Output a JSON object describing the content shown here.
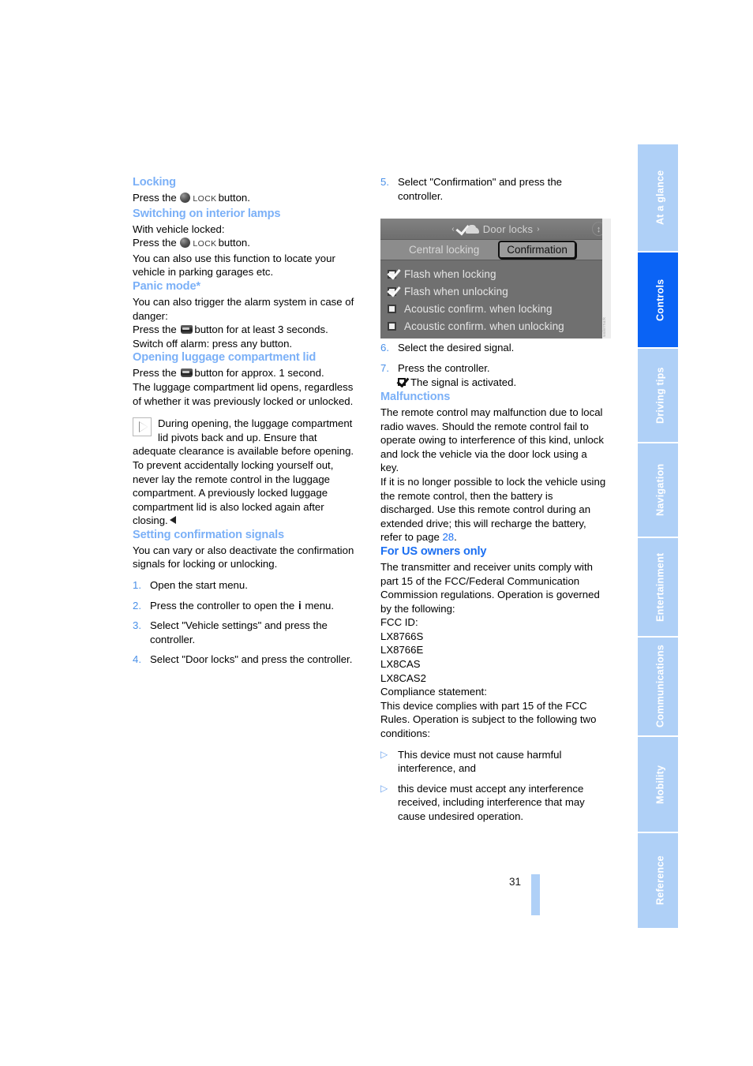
{
  "page": {
    "number": "31"
  },
  "tab_rail": {
    "items": [
      {
        "label": "At a glance",
        "active": false
      },
      {
        "label": "Controls",
        "active": true
      },
      {
        "label": "Driving tips",
        "active": false
      },
      {
        "label": "Navigation",
        "active": false
      },
      {
        "label": "Entertainment",
        "active": false
      },
      {
        "label": "Communications",
        "active": false
      },
      {
        "label": "Mobility",
        "active": false
      },
      {
        "label": "Reference",
        "active": false
      }
    ],
    "active_color": "#0A63F5",
    "inactive_color": "#AFD0F7"
  },
  "colors": {
    "heading_light_blue": "#7BB0F7",
    "heading_strong_blue": "#1B6FF2",
    "list_number_blue": "#4A90E8",
    "body_text": "#000000"
  },
  "left_column": {
    "locking": {
      "heading": "Locking",
      "press_the": "Press the",
      "lock_word": "LOCK",
      "button_word": "button."
    },
    "interior_lamps": {
      "heading": "Switching on interior lamps",
      "line1": "With vehicle locked:",
      "press_the": "Press the",
      "lock_word": "LOCK",
      "button_word": "button.",
      "line3": "You can also use this function to locate your vehicle in parking garages etc."
    },
    "panic_mode": {
      "heading": "Panic mode*",
      "intro": "You can also trigger the alarm system in case of danger:",
      "press_the": "Press the",
      "press_tail": "button for at least 3 seconds.",
      "switch_off": "Switch off alarm: press any button."
    },
    "luggage": {
      "heading": "Opening luggage compartment lid",
      "press_the": "Press the",
      "press_tail": "button for approx. 1 second.",
      "para1": "The luggage compartment lid opens, regardless of whether it was previously locked or unlocked.",
      "note": "During opening, the luggage compartment lid pivots back and up. Ensure that adequate clearance is available before opening. To prevent accidentally locking yourself out, never lay the remote control in the luggage compartment. A previously locked luggage compartment lid is also locked again after closing."
    },
    "confirmation_signals": {
      "heading": "Setting confirmation signals",
      "intro": "You can vary or also deactivate the confirmation signals for locking or unlocking.",
      "steps": [
        {
          "num": "1.",
          "text": "Open the start menu."
        },
        {
          "num": "2.",
          "text_before": "Press the controller to open the",
          "icon": "i",
          "text_after": "menu."
        },
        {
          "num": "3.",
          "text": "Select \"Vehicle settings\" and press the controller."
        },
        {
          "num": "4.",
          "text": "Select \"Door locks\" and press the controller."
        }
      ]
    }
  },
  "right_column": {
    "step5": {
      "num": "5.",
      "text": "Select \"Confirmation\" and press the controller."
    },
    "lcd": {
      "title": "Door locks",
      "arrow_left": "‹",
      "arrow_right": "›",
      "updown_glyph": "↕",
      "tab_inactive": "Central locking",
      "tab_active": "Confirmation",
      "options": [
        {
          "label": "Flash when locking",
          "checked": true
        },
        {
          "label": "Flash when unlocking",
          "checked": true
        },
        {
          "label": "Acoustic confirm. when locking",
          "checked": false
        },
        {
          "label": "Acoustic confirm. when unlocking",
          "checked": false
        }
      ],
      "watermark": "watermark"
    },
    "step6": {
      "num": "6.",
      "text": "Select the desired signal."
    },
    "step7": {
      "num": "7.",
      "text": "Press the controller.",
      "sub_text": "The signal is activated."
    },
    "malfunctions": {
      "heading": "Malfunctions",
      "para1": "The remote control may malfunction due to local radio waves. Should the remote control fail to operate owing to interference of this kind, unlock and lock the vehicle via the door lock using a key.",
      "para2_before": "If it is no longer possible to lock the vehicle using the remote control, then the battery is discharged. Use this remote control during an extended drive; this will recharge the battery, refer to page",
      "page_ref": "28",
      "para2_after": "."
    },
    "us_owners": {
      "heading": "For US owners only",
      "para1": "The transmitter and receiver units comply with part 15 of the FCC/Federal Communication Commission regulations. Operation is governed by the following:",
      "fcc_id_label": "FCC ID:",
      "fcc_ids": [
        "LX8766S",
        "LX8766E",
        "LX8CAS",
        "LX8CAS2"
      ],
      "compliance_label": "Compliance statement:",
      "compliance_text": "This device complies with part 15 of the FCC Rules. Operation is subject to the following two conditions:",
      "conditions": [
        "This device must not cause harmful interference, and",
        "this device must accept any interference received, including interference that may cause undesired operation."
      ]
    }
  }
}
